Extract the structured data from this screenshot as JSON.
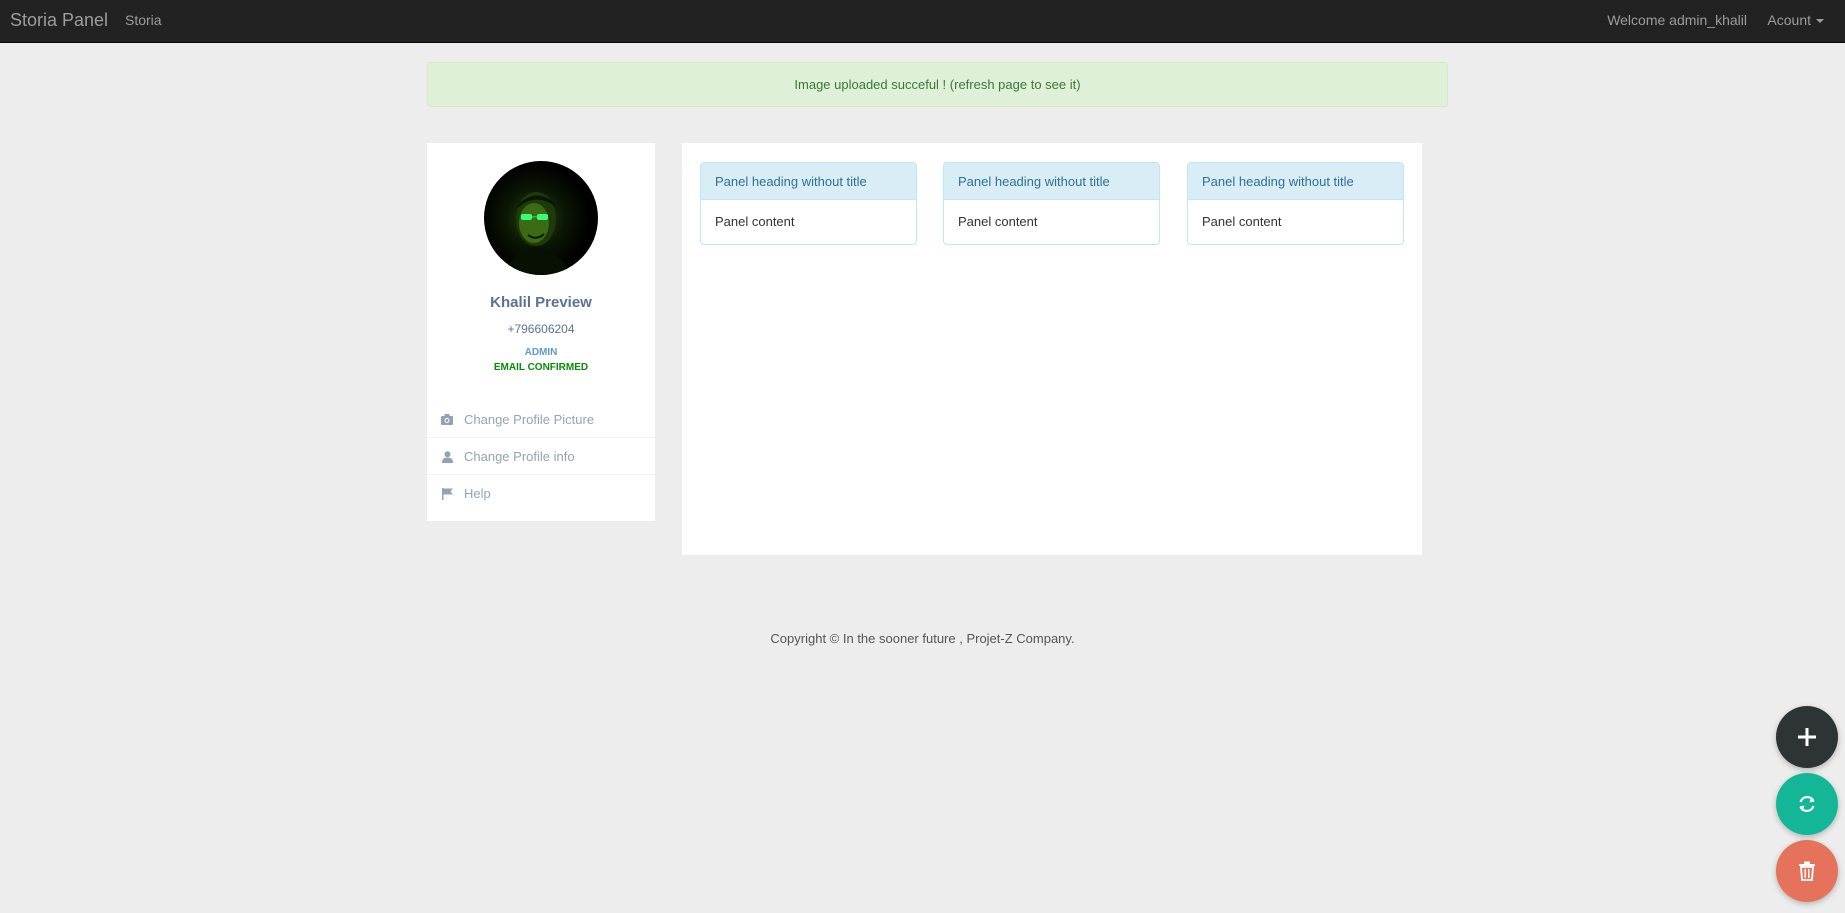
{
  "navbar": {
    "brand": "Storia Panel",
    "link": "Storia",
    "welcome": "Welcome admin_khalil",
    "account": "Acount"
  },
  "alert": {
    "message": "Image uploaded succeful ! (refresh page to see it)"
  },
  "profile": {
    "name": "Khalil Preview",
    "phone": "+796606204",
    "role": "ADMIN",
    "email_status": "EMAIL CONFIRMED"
  },
  "menu": [
    {
      "label": "Change Profile Picture",
      "icon": "camera-icon"
    },
    {
      "label": "Change Profile info",
      "icon": "user-icon"
    },
    {
      "label": "Help",
      "icon": "flag-icon"
    }
  ],
  "panels": [
    {
      "heading": "Panel heading without title",
      "body": "Panel content"
    },
    {
      "heading": "Panel heading without title",
      "body": "Panel content"
    },
    {
      "heading": "Panel heading without title",
      "body": "Panel content"
    }
  ],
  "footer": {
    "text": "Copyright © In the sooner future , Projet-Z Company."
  },
  "fabs": [
    {
      "icon": "plus-icon",
      "color": "#2e3336"
    },
    {
      "icon": "refresh-icon",
      "color": "#13b797"
    },
    {
      "icon": "trash-icon",
      "color": "#e5725a"
    }
  ],
  "colors": {
    "navbar_bg": "#222222",
    "alert_bg": "#dff0d8",
    "alert_text": "#3c763d",
    "panel_heading_bg": "#d9edf7",
    "role_color": "#5b9bd1",
    "email_confirmed_color": "#0a8a0a"
  }
}
